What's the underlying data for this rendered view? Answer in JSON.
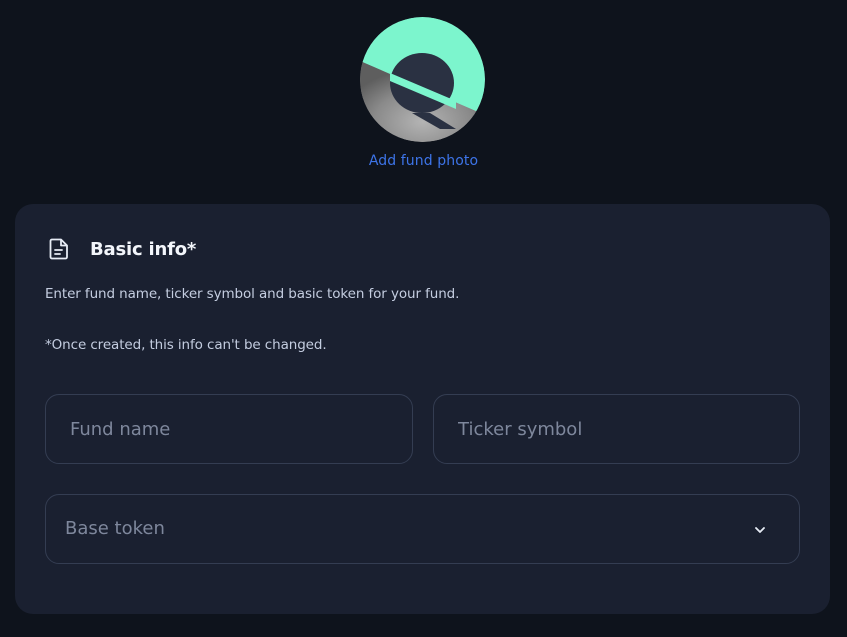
{
  "photo": {
    "add_label": "Add fund photo",
    "icon": "fund-logo-icon",
    "colors": {
      "accent": "#7cf5cd",
      "link": "#3d74e8"
    }
  },
  "basic_info": {
    "title": "Basic info*",
    "icon": "document-icon",
    "description": "Enter fund name, ticker symbol and basic token for your fund.",
    "note": "*Once created, this info can't be changed.",
    "fund_name": {
      "value": "",
      "placeholder": "Fund name"
    },
    "ticker_symbol": {
      "value": "",
      "placeholder": "Ticker symbol"
    },
    "base_token": {
      "label": "Base token",
      "icon": "chevron-down-icon"
    }
  }
}
